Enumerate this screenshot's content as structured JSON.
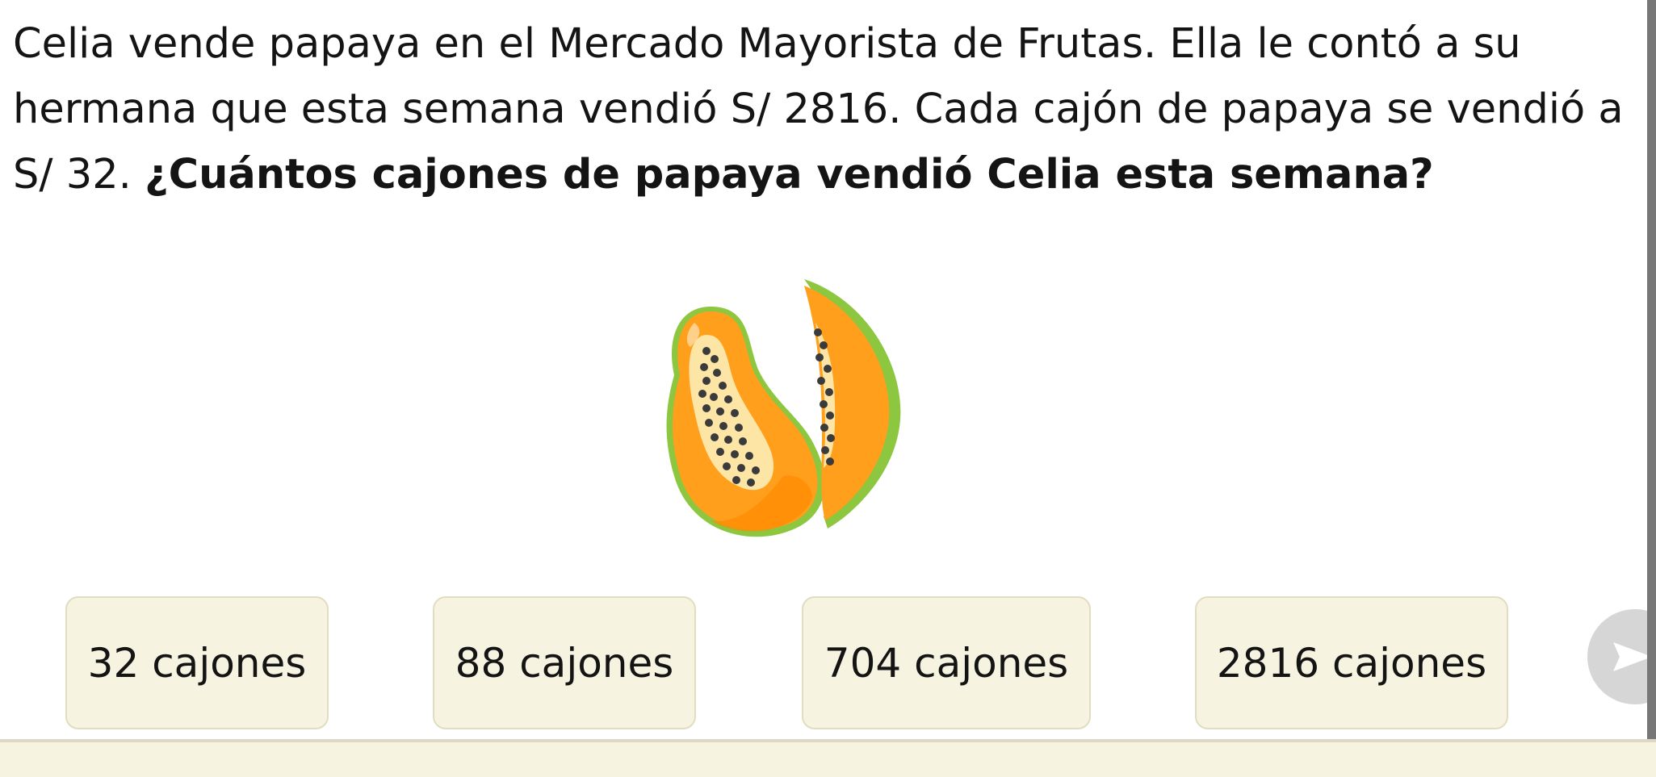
{
  "question": {
    "line1": "Celia vende papaya en el Mercado Mayorista de Frutas. Ella le contó a su",
    "line2": "hermana que esta semana vendió S/ 2816. Cada cajón de papaya se vendió a",
    "line3_plain": "S/ 32. ",
    "line3_bold": "¿Cuántos cajones de papaya vendió Celia esta semana?"
  },
  "illustration": {
    "icon": "papaya-icon"
  },
  "options": [
    {
      "label": "32 cajones"
    },
    {
      "label": "88 cajones"
    },
    {
      "label": "704 cajones"
    },
    {
      "label": "2816 cajones"
    }
  ],
  "next_button": {
    "icon": "send-arrow-icon"
  },
  "colors": {
    "option_background": "#f6f3e0",
    "option_border": "#e2ddc1",
    "papaya_orange": "#ff9f1c",
    "papaya_green": "#8dc63f",
    "next_button": "#d6d6d6"
  }
}
